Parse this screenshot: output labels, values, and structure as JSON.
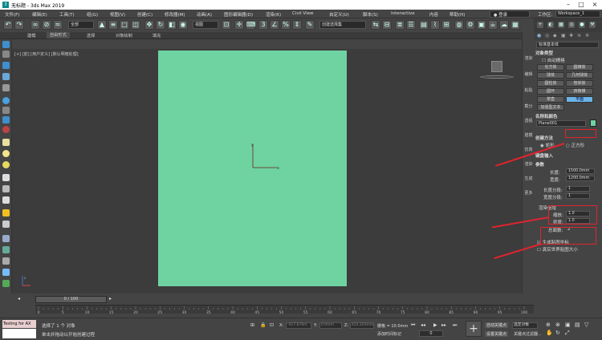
{
  "titlebar": {
    "title": "无标题 - 3ds Max 2019"
  },
  "menu": [
    "文件(F)",
    "编辑(E)",
    "工具(T)",
    "组(G)",
    "视图(V)",
    "创建(C)",
    "修改器(M)",
    "动画(A)",
    "图形编辑器(D)",
    "渲染(R)",
    "Civil View",
    "自定义(U)",
    "脚本(S)",
    "Interactive",
    "内容",
    "帮助(H)"
  ],
  "account": {
    "user": "登录",
    "workspace_label": "工作区:",
    "workspace": "Workspace_1"
  },
  "toolbar": {
    "filter": "全部",
    "view_dropdown": "视图",
    "selection_set": "创建选择集"
  },
  "ribbon": {
    "tabs": [
      "建模",
      "自由形式",
      "选择",
      "对象绘制",
      "填充"
    ],
    "active": 1
  },
  "viewport": {
    "label": "[+] [前] [用户定义] [默认明暗处理]",
    "axis_x": "x",
    "axis_y": "y",
    "axis_z": "z"
  },
  "cmd_tabs": [
    "渲染",
    "编辑",
    "粘贴",
    "截分",
    "透视",
    "建模",
    "仿真",
    "渲染",
    "生成",
    "更多"
  ],
  "panel": {
    "category": "标准基本体",
    "object_type": "对象类型",
    "autogrid": "自动栅格",
    "buttons": [
      "长方体",
      "圆锥体",
      "球体",
      "几何球体",
      "圆柱体",
      "管状体",
      "圆环",
      "四棱锥",
      "茶壶",
      "平面"
    ],
    "selected": "平面",
    "more": "加强型文本",
    "name_color": "名称和颜色",
    "object_name": "Plane001",
    "color": "#6fd2a1",
    "creation_method": "创建方法",
    "rect": "矩形",
    "square": "正方形",
    "keyboard": "键盘输入",
    "params": "参数",
    "length_label": "长度:",
    "length": "1500.0mm",
    "width_label": "宽度:",
    "width": "1200.0mm",
    "len_segs_label": "长度分段:",
    "len_segs": "1",
    "wid_segs_label": "宽度分段:",
    "wid_segs": "1",
    "render_mult": "渲染倍增",
    "scale_label": "缩放:",
    "scale": "1.0",
    "density_label": "密度:",
    "density": "1.0",
    "total_faces_label": "总面数:",
    "total_faces": "2",
    "gen_map": "生成贴图坐标",
    "real_world": "真实世界贴图大小"
  },
  "timeline": {
    "frame": "0 / 100",
    "ticks": [
      "0",
      "5",
      "10",
      "15",
      "20",
      "25",
      "30",
      "35",
      "40",
      "45",
      "50",
      "55",
      "60",
      "65",
      "70",
      "75",
      "80",
      "85",
      "90",
      "95",
      "100"
    ]
  },
  "status": {
    "script1": "Testing for AX",
    "script2": "",
    "selected": "选择了 1 个 对象",
    "hint": "单击并拖动以开始创建过程",
    "x_label": "X:",
    "x": "-417.676m",
    "y_label": "Y:",
    "y": "0.0mm",
    "z_label": "Z:",
    "z": "422.203mm",
    "grid": "栅格 = 10.0mm",
    "add_time": "添加时间标记",
    "autokey": "自动关键点",
    "selection": "选定对象",
    "setkey": "设置关键点",
    "filter": "关键点过滤器...",
    "frame": "0"
  }
}
